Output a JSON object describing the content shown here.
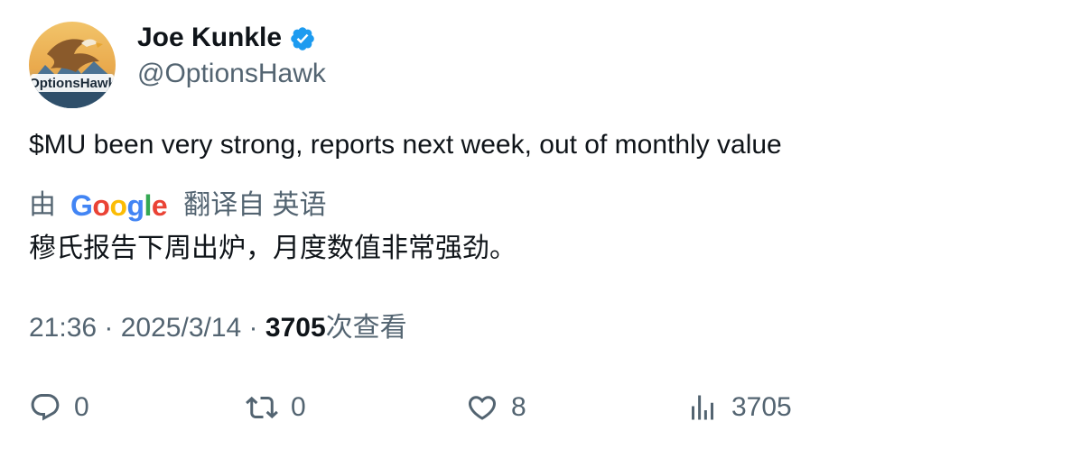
{
  "author": {
    "display_name": "Joe Kunkle",
    "handle": "@OptionsHawk",
    "verified": true,
    "avatar_text": "OptionsHawk"
  },
  "tweet": {
    "text": "$MU been very strong, reports next week, out of monthly value"
  },
  "translation": {
    "prefix": "由",
    "provider": "Google",
    "label": "翻译自 英语",
    "text": "穆氏报告下周出炉，月度数值非常强劲。"
  },
  "meta": {
    "time": "21:36",
    "separator": " · ",
    "date": "2025/3/14",
    "views_count": "3705",
    "views_suffix": "次查看"
  },
  "actions": {
    "reply_count": "0",
    "retweet_count": "0",
    "like_count": "8",
    "views_count": "3705"
  },
  "colors": {
    "text": "#0f1419",
    "secondary": "#536471",
    "verified": "#1d9bf0",
    "google_blue": "#4285f4",
    "google_red": "#ea4335",
    "google_yellow": "#fbbc05",
    "google_green": "#34a853"
  },
  "icons": {
    "verified": "verified-badge-icon",
    "reply": "speech-bubble-icon",
    "retweet": "retweet-arrows-icon",
    "like": "heart-icon",
    "views": "bar-chart-icon"
  }
}
